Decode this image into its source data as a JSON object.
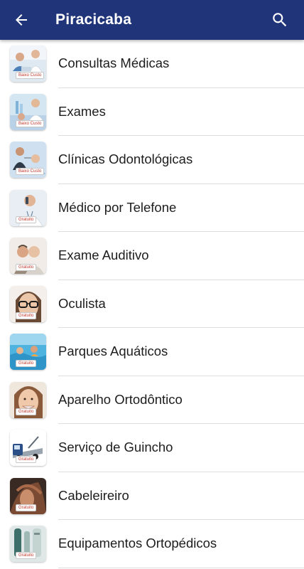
{
  "appbar": {
    "title": "Piracicaba",
    "color": "#1f3479"
  },
  "items": [
    {
      "label": "Consultas Médicas",
      "badge": "Baixo Custo",
      "icon": "doctor-consultation-photo"
    },
    {
      "label": "Exames",
      "badge": "Baixo Custo",
      "icon": "lab-exam-photo"
    },
    {
      "label": "Clínicas Odontológicas",
      "badge": "Baixo Custo",
      "icon": "dentist-photo"
    },
    {
      "label": "Médico por Telefone",
      "badge": "Gratuito",
      "icon": "phone-doctor-photo"
    },
    {
      "label": "Exame Auditivo",
      "badge": "Gratuito",
      "icon": "hearing-exam-photo"
    },
    {
      "label": "Oculista",
      "badge": "Gratuito",
      "icon": "glasses-photo"
    },
    {
      "label": "Parques Aquáticos",
      "badge": "Gratuito",
      "icon": "water-park-photo"
    },
    {
      "label": "Aparelho Ortodôntico",
      "badge": "Gratuito",
      "icon": "braces-smile-photo"
    },
    {
      "label": "Serviço de Guincho",
      "badge": "Gratuito",
      "icon": "tow-truck-photo"
    },
    {
      "label": "Cabeleireiro",
      "badge": "Gratuito",
      "icon": "hairdresser-photo"
    },
    {
      "label": "Equipamentos Ortopédicos",
      "badge": "Gratuito",
      "icon": "orthopedic-equipment-photo"
    }
  ]
}
